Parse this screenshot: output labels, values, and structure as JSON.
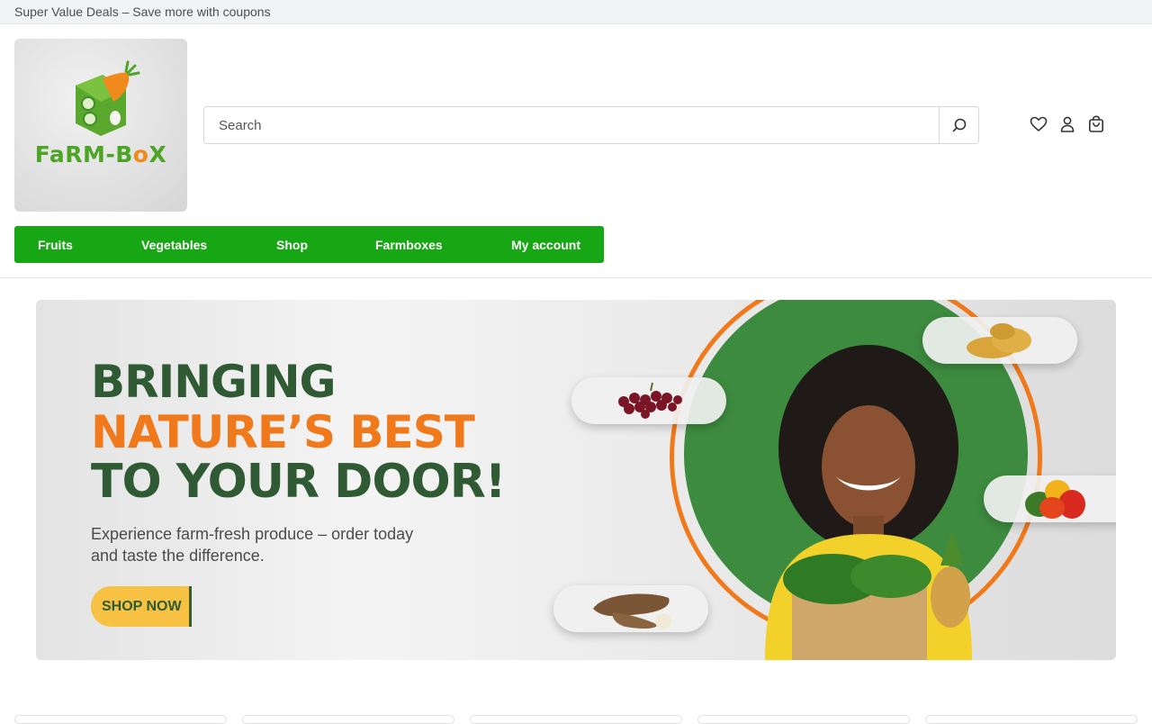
{
  "promo_bar": {
    "text": "Super Value Deals – Save more with coupons"
  },
  "brand": {
    "name_part1": "Fa",
    "name_part2": "RM-B",
    "name_part3": "o",
    "name_part4": "X"
  },
  "search": {
    "placeholder": "Search",
    "value": ""
  },
  "header_icons": [
    "heart-icon",
    "user-icon",
    "shopping-bag-icon"
  ],
  "nav": {
    "items": [
      {
        "label": "Fruits"
      },
      {
        "label": "Vegetables"
      },
      {
        "label": "Shop"
      },
      {
        "label": "Farmboxes"
      },
      {
        "label": "My account"
      }
    ]
  },
  "hero": {
    "line1": "BRINGING",
    "line2": "NATURE’S BEST",
    "line3": "TO YOUR DOOR!",
    "subtitle": "Experience farm-fresh produce – order today and taste the difference.",
    "cta": "SHOP NOW"
  },
  "colors": {
    "nav_green": "#17a614",
    "hero_dark_green": "#2f5a33",
    "hero_orange": "#f07a1b",
    "cta_yellow": "#f7c244"
  }
}
